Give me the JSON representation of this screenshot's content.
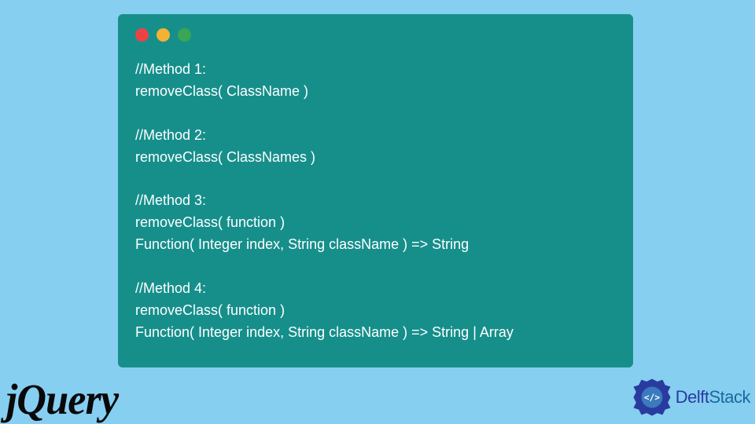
{
  "code": {
    "lines": [
      "//Method 1:",
      "removeClass( ClassName )",
      "",
      "//Method 2:",
      "removeClass( ClassNames )",
      "",
      "//Method 3:",
      "removeClass( function )",
      "Function( Integer index, String className ) => String",
      "",
      "//Method 4:",
      "removeClass( function )",
      "Function( Integer index, String className ) => String | Array"
    ]
  },
  "logos": {
    "jquery": "jQuery",
    "delft_prefix": "Delft",
    "delft_suffix": "Stack"
  },
  "colors": {
    "bg": "#86cff1",
    "window": "#168f8b",
    "text": "#ffffff",
    "red": "#ed4245",
    "yellow": "#f5b132",
    "green": "#3aa655",
    "jquery": "#090909",
    "delft_blue": "#2a3b9f"
  }
}
